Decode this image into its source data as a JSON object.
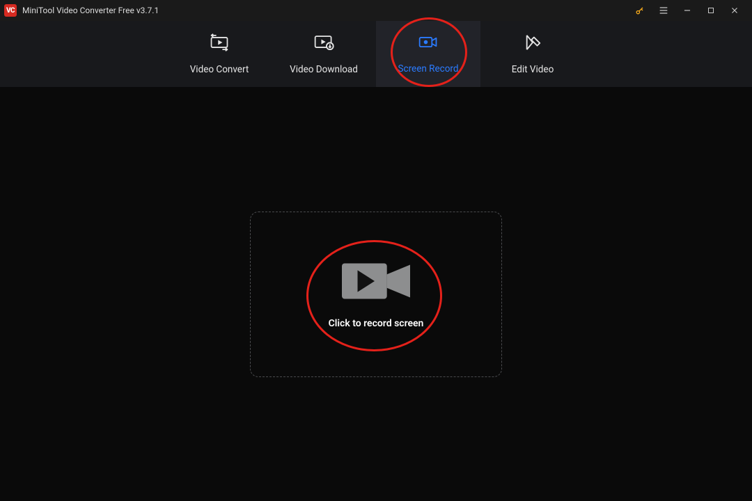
{
  "titlebar": {
    "app_icon_letters": "VC",
    "title": "MiniTool Video Converter Free v3.7.1"
  },
  "nav": {
    "tabs": [
      {
        "id": "video-convert",
        "label": "Video Convert"
      },
      {
        "id": "video-download",
        "label": "Video Download"
      },
      {
        "id": "screen-record",
        "label": "Screen Record"
      },
      {
        "id": "edit-video",
        "label": "Edit Video"
      }
    ],
    "active_tab": "screen-record"
  },
  "main": {
    "record_prompt": "Click to record screen"
  },
  "colors": {
    "accent": "#2b7bff",
    "annotation_red": "#e4211a",
    "brand_red": "#d62a21"
  }
}
